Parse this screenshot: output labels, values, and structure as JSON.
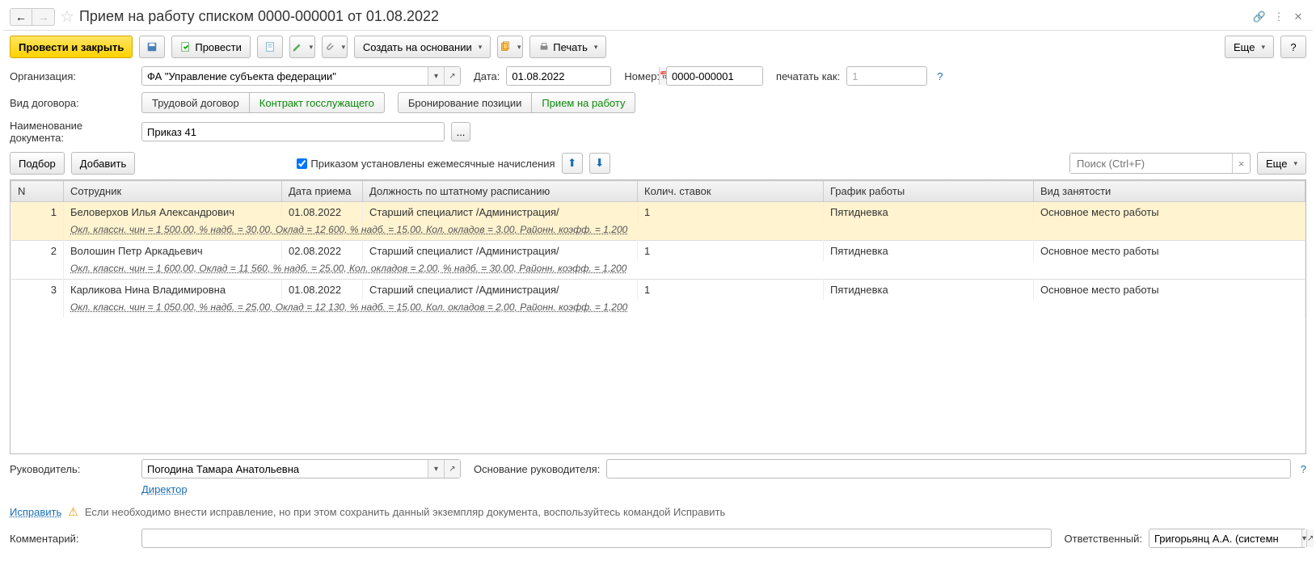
{
  "header": {
    "title": "Прием на работу списком 0000-000001 от 01.08.2022"
  },
  "toolbar": {
    "post_close": "Провести и закрыть",
    "post": "Провести",
    "create_based": "Создать на основании",
    "print": "Печать",
    "more": "Еще",
    "help": "?"
  },
  "form": {
    "org_label": "Организация:",
    "org_value": "ФА \"Управление субъекта федерации\"",
    "date_label": "Дата:",
    "date_value": "01.08.2022",
    "number_label": "Номер:",
    "number_value": "0000-000001",
    "print_as_label": "печатать как:",
    "print_as_value": "1",
    "contract_type_label": "Вид договора:",
    "seg1": "Трудовой договор",
    "seg2": "Контракт госслужащего",
    "seg3": "Бронирование позиции",
    "seg4": "Прием на работу",
    "doc_name_label": "Наименование документа:",
    "doc_name_value": "Приказ 41",
    "doc_name_btn": "..."
  },
  "table_toolbar": {
    "select": "Подбор",
    "add": "Добавить",
    "checkbox_label": "Приказом установлены ежемесячные начисления",
    "search_placeholder": "Поиск (Ctrl+F)",
    "more": "Еще"
  },
  "table": {
    "headers": {
      "n": "N",
      "employee": "Сотрудник",
      "date": "Дата приема",
      "position": "Должность по штатному расписанию",
      "rates": "Колич. ставок",
      "schedule": "График работы",
      "employment": "Вид занятости"
    },
    "rows": [
      {
        "n": "1",
        "employee": "Беловерхов Илья Александрович",
        "date": "01.08.2022",
        "position": "Старший специалист /Администрация/",
        "rates": "1",
        "schedule": "Пятидневка",
        "employment": "Основное место работы",
        "detail": "Окл. классн. чин = 1 500,00, % надб. = 30,00, Оклад = 12 600, % надб. = 15,00, Кол. окладов = 3,00, Районн. коэфф. = 1,200",
        "highlighted": true
      },
      {
        "n": "2",
        "employee": "Волошин Петр Аркадьевич",
        "date": "02.08.2022",
        "position": "Старший специалист /Администрация/",
        "rates": "1",
        "schedule": "Пятидневка",
        "employment": "Основное место работы",
        "detail": "Окл. классн. чин = 1 600,00, Оклад = 11 560, % надб. = 25,00, Кол. окладов = 2,00, % надб. = 30,00, Районн. коэфф. = 1,200"
      },
      {
        "n": "3",
        "employee": "Карликова Нина Владимировна",
        "date": "01.08.2022",
        "position": "Старший специалист /Администрация/",
        "rates": "1",
        "schedule": "Пятидневка",
        "employment": "Основное место работы",
        "detail": "Окл. классн. чин = 1 050,00, % надб. = 25,00, Оклад = 12 130, % надб. = 15,00, Кол. окладов = 2,00, Районн. коэфф. = 1,200"
      }
    ]
  },
  "footer": {
    "manager_label": "Руководитель:",
    "manager_value": "Погодина Тамара Анатольевна",
    "manager_position": "Директор",
    "manager_basis_label": "Основание руководителя:",
    "fix_link": "Исправить",
    "warn_text": "Если необходимо внести исправление, но при этом сохранить данный экземпляр документа, воспользуйтесь командой Исправить",
    "comment_label": "Комментарий:",
    "responsible_label": "Ответственный:",
    "responsible_value": "Григорьянц А.А. (системн"
  }
}
